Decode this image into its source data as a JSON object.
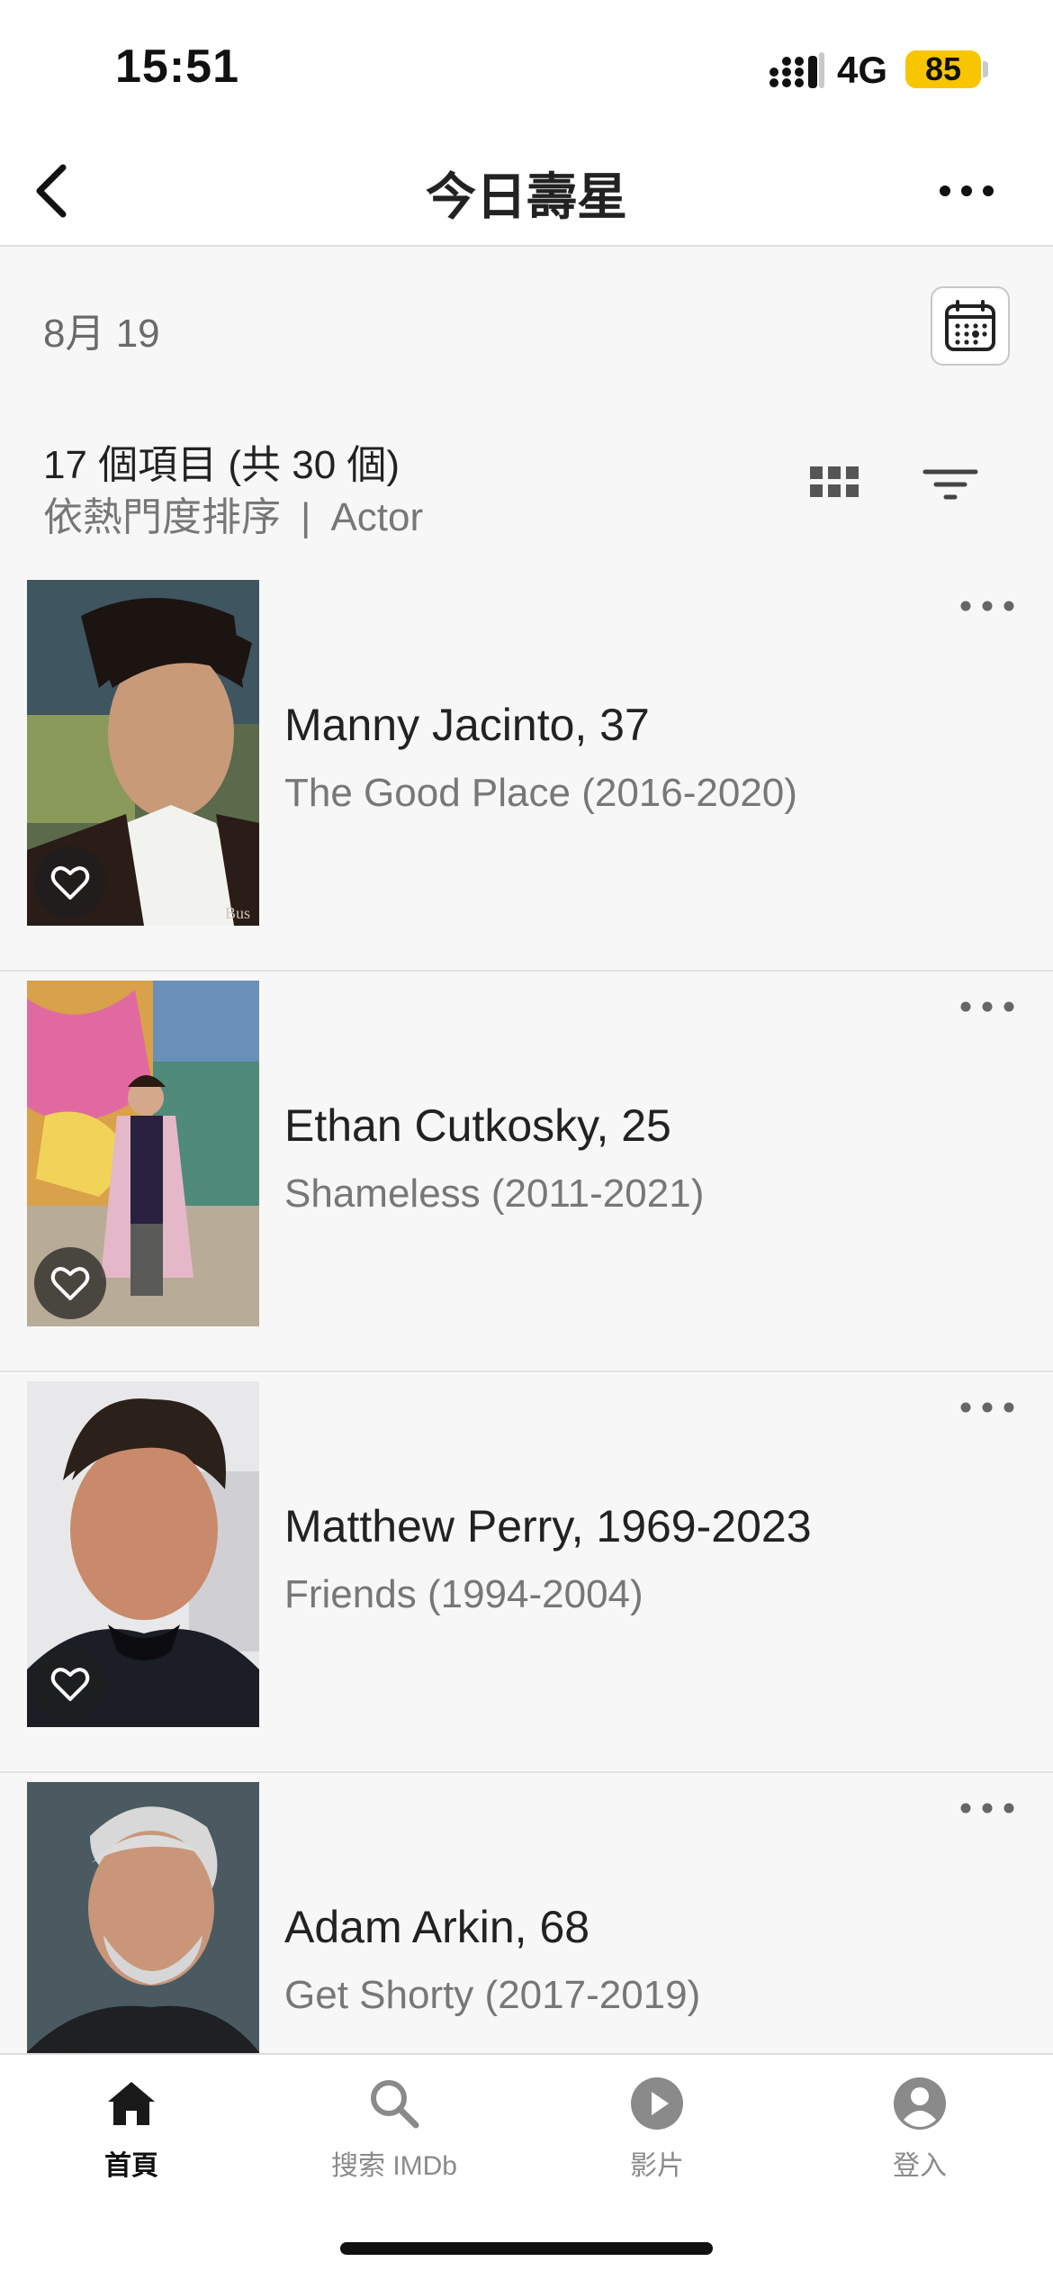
{
  "status": {
    "time": "15:51",
    "network": "4G",
    "battery": "85"
  },
  "nav": {
    "title": "今日壽星"
  },
  "date": {
    "label": "8月 19"
  },
  "summary": {
    "count": "17 個項目 (共 30 個)",
    "sort": "依熱門度排序",
    "separator": "|",
    "filter": "Actor"
  },
  "items": [
    {
      "name": "Manny Jacinto, 37",
      "known_for": "The Good Place (2016-2020)",
      "poster_watermark": "Bus"
    },
    {
      "name": "Ethan Cutkosky, 25",
      "known_for": "Shameless (2011-2021)"
    },
    {
      "name": "Matthew Perry, 1969-2023",
      "known_for": "Friends (1994-2004)"
    },
    {
      "name": "Adam Arkin, 68",
      "known_for": "Get Shorty (2017-2019)"
    }
  ],
  "tabs": [
    {
      "label": "首頁",
      "icon": "home-icon",
      "active": true
    },
    {
      "label": "搜索 IMDb",
      "icon": "search-icon",
      "active": false
    },
    {
      "label": "影片",
      "icon": "play-icon",
      "active": false
    },
    {
      "label": "登入",
      "icon": "account-icon",
      "active": false
    }
  ],
  "colors": {
    "battery": "#f7c600",
    "background": "#f7f7f7",
    "active_tab": "#111111",
    "inactive_tab": "#8a8a8a"
  }
}
